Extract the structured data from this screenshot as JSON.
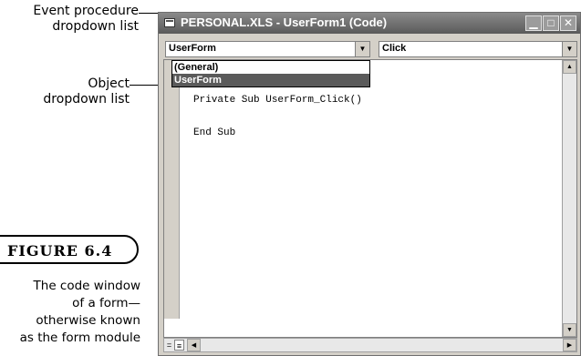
{
  "callouts": {
    "event_line1": "Event procedure",
    "event_line2": "dropdown list",
    "object_line1": "Object",
    "object_line2": "dropdown list"
  },
  "figure": {
    "label": "FIGURE 6.4",
    "caption_lines": [
      "The code window",
      "of a form—",
      "otherwise known",
      "as the form module"
    ]
  },
  "window": {
    "title": "PERSONAL.XLS - UserForm1 (Code)",
    "minimize_glyph": "▁",
    "maximize_glyph": "□",
    "close_glyph": "✕"
  },
  "object_dropdown": {
    "value": "UserForm",
    "options": [
      "(General)",
      "UserForm"
    ],
    "selected_index": 1
  },
  "procedure_dropdown": {
    "value": "Click"
  },
  "code": {
    "lines": [
      "Private Sub UserForm_Click()",
      "End Sub"
    ]
  },
  "icons": {
    "dropdown_arrow": "▼",
    "scroll_up": "▲",
    "scroll_down": "▼",
    "scroll_left": "◀",
    "scroll_right": "▶",
    "procedure_view": "=",
    "full_module_view": "≡"
  },
  "colors": {
    "titlebar": "#6e6e6e",
    "window_face": "#d4d0c8",
    "selection": "#5a5a5a"
  }
}
